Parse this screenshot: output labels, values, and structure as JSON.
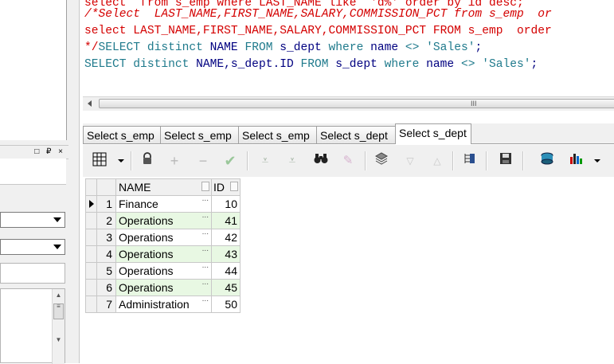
{
  "editor": {
    "lines": [
      {
        "segments": [
          {
            "cls": "c-red",
            "text": "select  from s_emp where LAST_NAME like  'd%' order by id desc;"
          }
        ]
      },
      {
        "segments": [
          {
            "cls": "c-comment",
            "text": "/*Select  LAST_NAME,FIRST_NAME,SALARY,COMMISSION_PCT from s_emp  or"
          }
        ]
      },
      {
        "segments": [
          {
            "cls": "c-red",
            "text": "select LAST_NAME,FIRST_NAME,SALARY,COMMISSION_PCT FROM s_emp  order"
          }
        ]
      },
      {
        "segments": [
          {
            "cls": "c-red",
            "text": "*/"
          },
          {
            "cls": "c-kw",
            "text": "SELECT distinct "
          },
          {
            "cls": "c-plain",
            "text": "NAME "
          },
          {
            "cls": "c-kw",
            "text": "FROM "
          },
          {
            "cls": "c-plain",
            "text": "s_dept "
          },
          {
            "cls": "c-kw",
            "text": "where "
          },
          {
            "cls": "c-plain",
            "text": "name "
          },
          {
            "cls": "c-kw",
            "text": "<> "
          },
          {
            "cls": "c-str",
            "text": "'Sales'"
          },
          {
            "cls": "c-plain",
            "text": ";"
          }
        ]
      },
      {
        "segments": [
          {
            "cls": "c-kw",
            "text": "SELECT distinct "
          },
          {
            "cls": "c-plain",
            "text": "NAME,s_dept.ID "
          },
          {
            "cls": "c-kw",
            "text": "FROM "
          },
          {
            "cls": "c-plain",
            "text": "s_dept "
          },
          {
            "cls": "c-kw",
            "text": "where "
          },
          {
            "cls": "c-plain",
            "text": "name "
          },
          {
            "cls": "c-kw",
            "text": "<> "
          },
          {
            "cls": "c-str",
            "text": "'Sales'"
          },
          {
            "cls": "c-plain",
            "text": ";"
          }
        ]
      }
    ]
  },
  "hscroll": {
    "grip": "III"
  },
  "left_panel": {
    "dock_buttons": "□ ₽ ×"
  },
  "tabs": [
    {
      "label": "Select s_emp",
      "active": false
    },
    {
      "label": "Select s_emp",
      "active": false
    },
    {
      "label": "Select s_emp",
      "active": false
    },
    {
      "label": "Select s_dept",
      "active": false
    },
    {
      "label": "Select s_dept",
      "active": true
    }
  ],
  "grid": {
    "columns": [
      "NAME",
      "ID"
    ],
    "rows": [
      {
        "n": "1",
        "name": "Finance",
        "id": "10"
      },
      {
        "n": "2",
        "name": "Operations",
        "id": "41"
      },
      {
        "n": "3",
        "name": "Operations",
        "id": "42"
      },
      {
        "n": "4",
        "name": "Operations",
        "id": "43"
      },
      {
        "n": "5",
        "name": "Operations",
        "id": "44"
      },
      {
        "n": "6",
        "name": "Operations",
        "id": "45"
      },
      {
        "n": "7",
        "name": "Administration",
        "id": "50"
      }
    ],
    "current_row": 0,
    "ellipsis": "..."
  },
  "colors": {
    "highlight": "#bcd6ee",
    "alt_row": "#e8f8e3",
    "keyword": "#1f7a8c",
    "comment": "#d40000"
  }
}
